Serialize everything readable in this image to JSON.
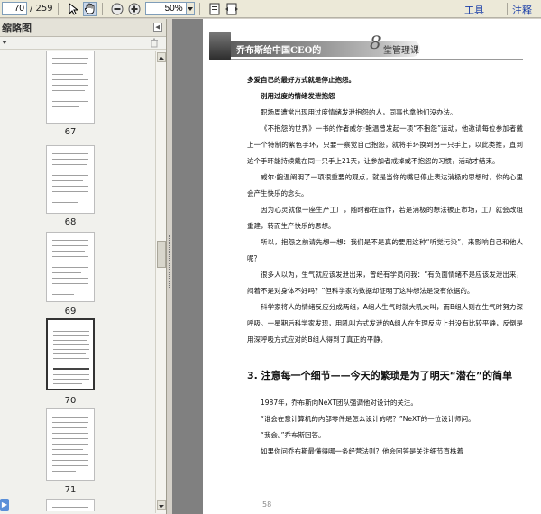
{
  "toolbar": {
    "page_current": "70",
    "page_total": "/ 259",
    "zoom_value": "50%",
    "menu_tools": "工具",
    "menu_comment": "注释"
  },
  "sidebar": {
    "title": "缩略图",
    "thumbnails": [
      {
        "label": "67"
      },
      {
        "label": "68"
      },
      {
        "label": "69"
      },
      {
        "label": "70"
      },
      {
        "label": "71"
      }
    ],
    "selected_thumbnail": "70"
  },
  "document": {
    "header_title": "乔布斯给中国CEO的",
    "header_number": "8",
    "header_title_rest": "堂管理课",
    "page_number": "58",
    "paragraphs": [
      {
        "style": "bold",
        "text": "多爱自己的最好方式就是停止抱怨。"
      },
      {
        "style": "sub",
        "text": "别用过度的情绪发泄抱怨"
      },
      {
        "style": "indent",
        "text": "职场周遭常出现用过度情绪发泄抱怨的人，同事也拿他们没办法。"
      },
      {
        "style": "indent",
        "text": "《不抱怨的世界》一书的作者威尔·鲍温曾发起一项“不抱怨”运动，他邀请每位参加者戴上一个特制的紫色手环，只要一察觉自己抱怨，就将手环换到另一只手上，以此类推，直到这个手环能持续戴在同一只手上21天，让参加者戒掉或不抱怨的习惯，活动才结束。"
      },
      {
        "style": "indent",
        "text": "威尔·鲍温阐明了一项很重要的观点，就是当你的嘴巴停止表达消极的思想时，你的心里会产生快乐的念头。"
      },
      {
        "style": "indent",
        "text": "因为心灵就像一座生产工厂，随时都在运作，若是消极的想法被正市场，工厂就会改组重建，转而生产快乐的思想。"
      },
      {
        "style": "indent",
        "text": "所以，抱怨之前请先想一想：我们是不是真的要用这种“听觉污染”，来影响自己和他人呢？"
      },
      {
        "style": "indent",
        "text": "很多人以为，生气就应该发泄出来，曾经有学员问我：“有负面情绪不是应该发泄出来，闷着不是对身体不好吗？”但科学家的数据却证明了这种想法是没有依据的。"
      },
      {
        "style": "indent",
        "text": "科学家将人的情绪反应分成两组，A组人生气时就大吼大叫，而B组人则在生气时努力深呼吸。一星期后科学家发现，用吼叫方式发泄的A组人在生理反应上并没有比较平静，反倒是用深呼吸方式应对的B组人得到了真正的平静。"
      }
    ],
    "section_heading": "3. 注意每一个细节——今天的繁琐是为了明天“潜在”的简单",
    "paragraphs_after": [
      {
        "style": "indent",
        "text": "1987年，乔布斯向NeXT团队强调他对设计的关注。"
      },
      {
        "style": "indent",
        "text": "“谁会在意计算机的内部零件是怎么设计的呢？”NeXT的一位设计师问。"
      },
      {
        "style": "indent",
        "text": "“我会。”乔布斯回答。"
      },
      {
        "style": "indent",
        "text": "如果你问乔布斯最懂得哪一条经营法则？他会回答是关注细节直株着"
      }
    ]
  }
}
